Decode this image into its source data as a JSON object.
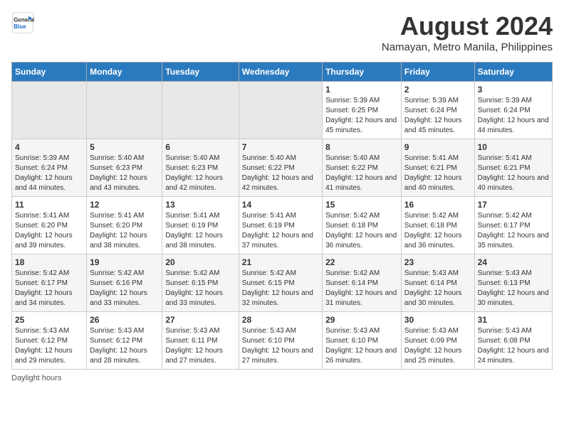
{
  "logo": {
    "line1": "General",
    "line2": "Blue"
  },
  "title": "August 2024",
  "subtitle": "Namayan, Metro Manila, Philippines",
  "days_of_week": [
    "Sunday",
    "Monday",
    "Tuesday",
    "Wednesday",
    "Thursday",
    "Friday",
    "Saturday"
  ],
  "footer": "Daylight hours",
  "weeks": [
    [
      {
        "day": "",
        "info": ""
      },
      {
        "day": "",
        "info": ""
      },
      {
        "day": "",
        "info": ""
      },
      {
        "day": "",
        "info": ""
      },
      {
        "day": "1",
        "info": "Sunrise: 5:39 AM\nSunset: 6:25 PM\nDaylight: 12 hours and 45 minutes."
      },
      {
        "day": "2",
        "info": "Sunrise: 5:39 AM\nSunset: 6:24 PM\nDaylight: 12 hours and 45 minutes."
      },
      {
        "day": "3",
        "info": "Sunrise: 5:39 AM\nSunset: 6:24 PM\nDaylight: 12 hours and 44 minutes."
      }
    ],
    [
      {
        "day": "4",
        "info": "Sunrise: 5:39 AM\nSunset: 6:24 PM\nDaylight: 12 hours and 44 minutes."
      },
      {
        "day": "5",
        "info": "Sunrise: 5:40 AM\nSunset: 6:23 PM\nDaylight: 12 hours and 43 minutes."
      },
      {
        "day": "6",
        "info": "Sunrise: 5:40 AM\nSunset: 6:23 PM\nDaylight: 12 hours and 42 minutes."
      },
      {
        "day": "7",
        "info": "Sunrise: 5:40 AM\nSunset: 6:22 PM\nDaylight: 12 hours and 42 minutes."
      },
      {
        "day": "8",
        "info": "Sunrise: 5:40 AM\nSunset: 6:22 PM\nDaylight: 12 hours and 41 minutes."
      },
      {
        "day": "9",
        "info": "Sunrise: 5:41 AM\nSunset: 6:21 PM\nDaylight: 12 hours and 40 minutes."
      },
      {
        "day": "10",
        "info": "Sunrise: 5:41 AM\nSunset: 6:21 PM\nDaylight: 12 hours and 40 minutes."
      }
    ],
    [
      {
        "day": "11",
        "info": "Sunrise: 5:41 AM\nSunset: 6:20 PM\nDaylight: 12 hours and 39 minutes."
      },
      {
        "day": "12",
        "info": "Sunrise: 5:41 AM\nSunset: 6:20 PM\nDaylight: 12 hours and 38 minutes."
      },
      {
        "day": "13",
        "info": "Sunrise: 5:41 AM\nSunset: 6:19 PM\nDaylight: 12 hours and 38 minutes."
      },
      {
        "day": "14",
        "info": "Sunrise: 5:41 AM\nSunset: 6:19 PM\nDaylight: 12 hours and 37 minutes."
      },
      {
        "day": "15",
        "info": "Sunrise: 5:42 AM\nSunset: 6:18 PM\nDaylight: 12 hours and 36 minutes."
      },
      {
        "day": "16",
        "info": "Sunrise: 5:42 AM\nSunset: 6:18 PM\nDaylight: 12 hours and 36 minutes."
      },
      {
        "day": "17",
        "info": "Sunrise: 5:42 AM\nSunset: 6:17 PM\nDaylight: 12 hours and 35 minutes."
      }
    ],
    [
      {
        "day": "18",
        "info": "Sunrise: 5:42 AM\nSunset: 6:17 PM\nDaylight: 12 hours and 34 minutes."
      },
      {
        "day": "19",
        "info": "Sunrise: 5:42 AM\nSunset: 6:16 PM\nDaylight: 12 hours and 33 minutes."
      },
      {
        "day": "20",
        "info": "Sunrise: 5:42 AM\nSunset: 6:15 PM\nDaylight: 12 hours and 33 minutes."
      },
      {
        "day": "21",
        "info": "Sunrise: 5:42 AM\nSunset: 6:15 PM\nDaylight: 12 hours and 32 minutes."
      },
      {
        "day": "22",
        "info": "Sunrise: 5:42 AM\nSunset: 6:14 PM\nDaylight: 12 hours and 31 minutes."
      },
      {
        "day": "23",
        "info": "Sunrise: 5:43 AM\nSunset: 6:14 PM\nDaylight: 12 hours and 30 minutes."
      },
      {
        "day": "24",
        "info": "Sunrise: 5:43 AM\nSunset: 6:13 PM\nDaylight: 12 hours and 30 minutes."
      }
    ],
    [
      {
        "day": "25",
        "info": "Sunrise: 5:43 AM\nSunset: 6:12 PM\nDaylight: 12 hours and 29 minutes."
      },
      {
        "day": "26",
        "info": "Sunrise: 5:43 AM\nSunset: 6:12 PM\nDaylight: 12 hours and 28 minutes."
      },
      {
        "day": "27",
        "info": "Sunrise: 5:43 AM\nSunset: 6:11 PM\nDaylight: 12 hours and 27 minutes."
      },
      {
        "day": "28",
        "info": "Sunrise: 5:43 AM\nSunset: 6:10 PM\nDaylight: 12 hours and 27 minutes."
      },
      {
        "day": "29",
        "info": "Sunrise: 5:43 AM\nSunset: 6:10 PM\nDaylight: 12 hours and 26 minutes."
      },
      {
        "day": "30",
        "info": "Sunrise: 5:43 AM\nSunset: 6:09 PM\nDaylight: 12 hours and 25 minutes."
      },
      {
        "day": "31",
        "info": "Sunrise: 5:43 AM\nSunset: 6:08 PM\nDaylight: 12 hours and 24 minutes."
      }
    ]
  ]
}
